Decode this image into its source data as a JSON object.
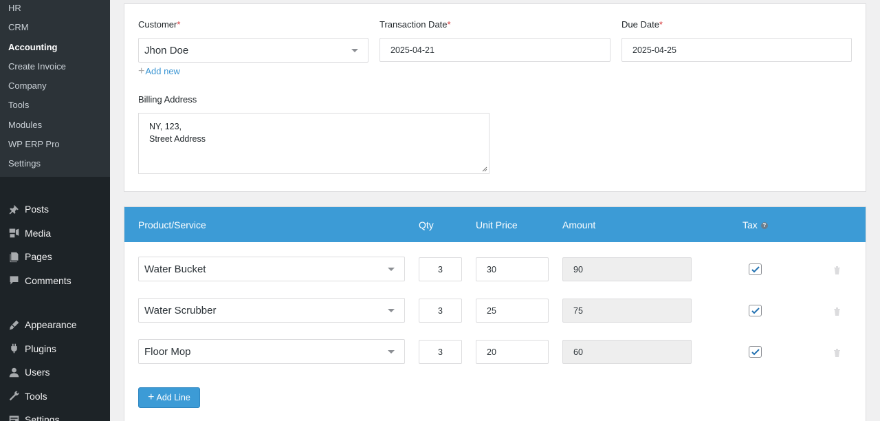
{
  "sidebar": {
    "submenu": [
      {
        "label": "HR",
        "current": false
      },
      {
        "label": "CRM",
        "current": false
      },
      {
        "label": "Accounting",
        "current": true
      },
      {
        "label": "Create Invoice",
        "current": false
      },
      {
        "label": "Company",
        "current": false
      },
      {
        "label": "Tools",
        "current": false
      },
      {
        "label": "Modules",
        "current": false
      },
      {
        "label": "WP ERP Pro",
        "current": false
      },
      {
        "label": "Settings",
        "current": false
      }
    ],
    "menu_group_1": [
      {
        "label": "Posts",
        "icon": "pushpin-icon"
      },
      {
        "label": "Media",
        "icon": "media-icon"
      },
      {
        "label": "Pages",
        "icon": "pages-icon"
      },
      {
        "label": "Comments",
        "icon": "comments-icon"
      }
    ],
    "menu_group_2": [
      {
        "label": "Appearance",
        "icon": "brush-icon"
      },
      {
        "label": "Plugins",
        "icon": "plugin-icon"
      },
      {
        "label": "Users",
        "icon": "users-icon"
      },
      {
        "label": "Tools",
        "icon": "wrench-icon"
      },
      {
        "label": "Settings",
        "icon": "settings-icon"
      }
    ]
  },
  "form": {
    "customer_label": "Customer",
    "customer_value": "Jhon Doe",
    "add_new_label": "Add new",
    "transaction_date_label": "Transaction Date",
    "transaction_date_value": "2025-04-21",
    "due_date_label": "Due Date",
    "due_date_value": "2025-04-25",
    "required_mark": "*",
    "billing_address_label": "Billing Address",
    "billing_address_line1": "NY, 123,",
    "billing_address_line2": "Street Address"
  },
  "lines": {
    "headers": {
      "product": "Product/Service",
      "qty": "Qty",
      "unit_price": "Unit Price",
      "amount": "Amount",
      "tax": "Tax",
      "tax_help": "?"
    },
    "rows": [
      {
        "product": "Water Bucket",
        "qty": "3",
        "unit_price": "30",
        "amount": "90",
        "tax": true
      },
      {
        "product": "Water Scrubber",
        "qty": "3",
        "unit_price": "25",
        "amount": "75",
        "tax": true
      },
      {
        "product": "Floor Mop",
        "qty": "3",
        "unit_price": "20",
        "amount": "60",
        "tax": true
      }
    ],
    "add_line_label": "Add Line"
  },
  "colors": {
    "accent": "#3c9bd6",
    "sidebar_bg": "#1d2327",
    "submenu_bg": "#2c3338",
    "required": "#d63638"
  }
}
